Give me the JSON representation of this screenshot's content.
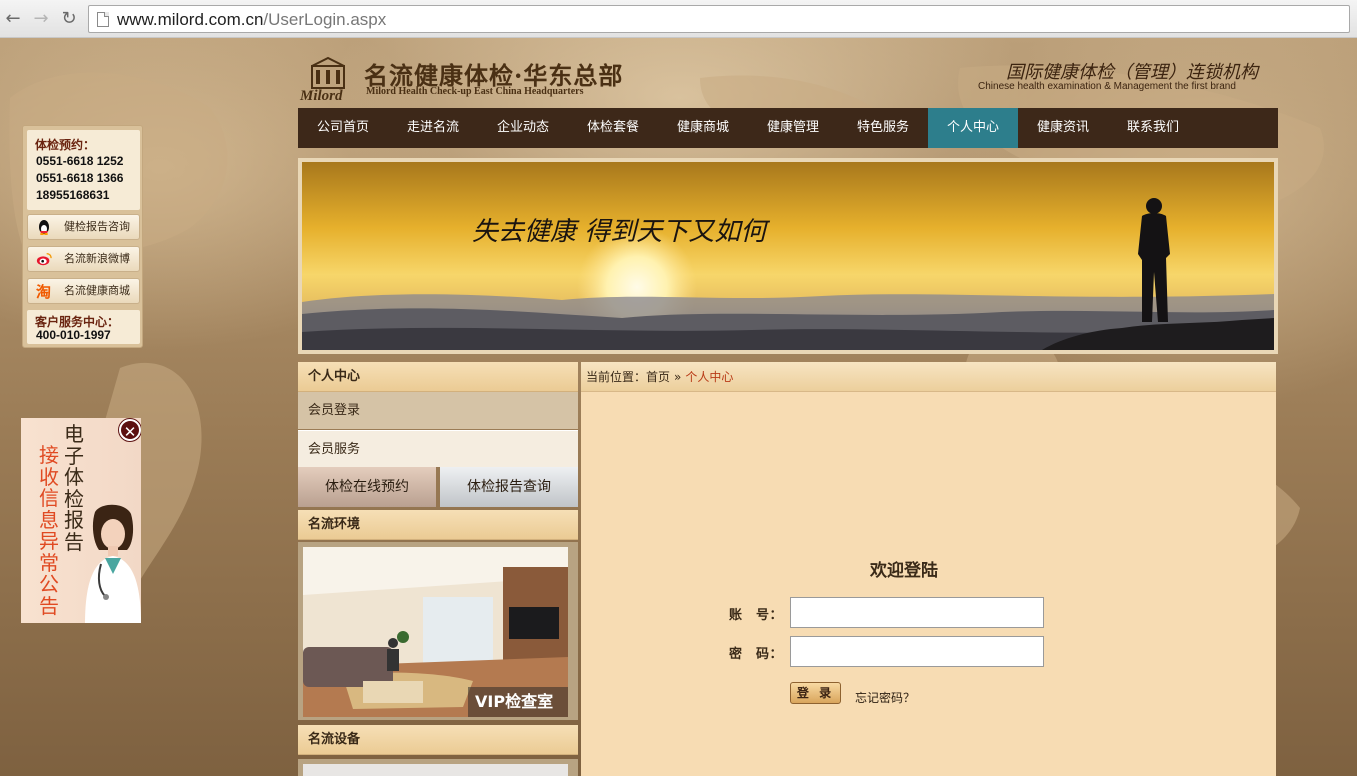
{
  "browser": {
    "url_host": "www.milord.com.cn",
    "url_path": "/UserLogin.aspx"
  },
  "header": {
    "logo_cn": "名流健康体检·华东总部",
    "logo_en": "Milord Health Check-up East China Headquarters",
    "logo_mark": "Milord",
    "slogan_cn": "国际健康体检（管理）连锁机构",
    "slogan_en": "Chinese health examination & Management the first brand"
  },
  "nav": {
    "items": [
      "公司首页",
      "走进名流",
      "企业动态",
      "体检套餐",
      "健康商城",
      "健康管理",
      "特色服务",
      "个人中心",
      "健康资讯",
      "联系我们"
    ],
    "active_index": 7,
    "active_color": "#2d7e8c"
  },
  "banner": {
    "calligraphy": "失去健康 得到天下又如何"
  },
  "contact_panel": {
    "title": "体检预约：",
    "phones": [
      "0551-6618 1252",
      "0551-6618 1366",
      "18955168631"
    ],
    "buttons": [
      {
        "label": "健检报告咨询",
        "icon": "qq-penguin-icon"
      },
      {
        "label": "名流新浪微博",
        "icon": "weibo-icon"
      },
      {
        "label": "名流健康商城",
        "icon": "taobao-icon"
      }
    ],
    "service_title": "客户服务中心：",
    "service_phone": "400-010-1997"
  },
  "ad": {
    "col1": "电子体检报告",
    "col2": "接收信息异常公告"
  },
  "sidebar": {
    "title": "个人中心",
    "items": [
      "会员登录",
      "会员服务"
    ],
    "buttons": [
      "体检在线预约",
      "体检报告查询"
    ],
    "env_title": "名流环境",
    "env_caption": "VIP检查室",
    "equip_title": "名流设备"
  },
  "breadcrumb": {
    "prefix": "当前位置：",
    "home": "首页",
    "separator": "»",
    "current": "个人中心"
  },
  "login": {
    "title": "欢迎登陆",
    "account_label": "账　号：",
    "password_label": "密　码：",
    "account_value": "",
    "password_value": "",
    "submit_label": "登 录",
    "forgot_label": "忘记密码？"
  },
  "colors": {
    "nav_bg": "#3d2819",
    "content_bg": "#f7dcb3",
    "crumb_current": "#b83a16"
  }
}
